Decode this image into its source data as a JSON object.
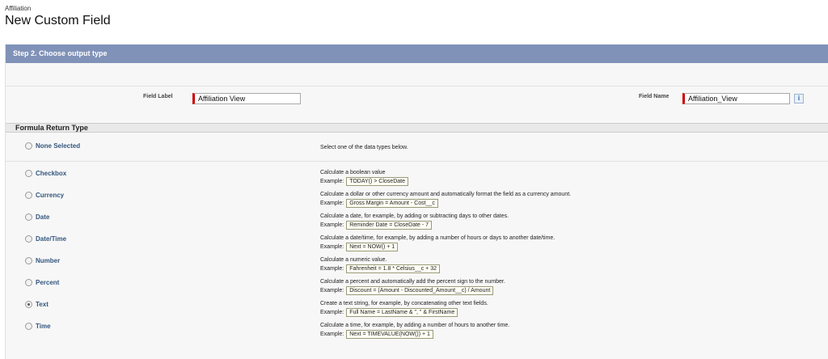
{
  "header": {
    "breadcrumb": "Affiliation",
    "title": "New Custom Field"
  },
  "step": {
    "title": "Step 2. Choose output type"
  },
  "fields": {
    "field_label": "Field Label",
    "field_label_value": "Affiliation View",
    "field_name": "Field Name",
    "field_name_value": "Affiliation_View",
    "info_label": "i"
  },
  "formula": {
    "section_title": "Formula Return Type",
    "example_prefix": "Example:",
    "none": {
      "label": "None Selected",
      "description": "Select one of the data types below."
    },
    "types": [
      {
        "label": "Checkbox",
        "description": "Calculate a boolean value",
        "example": "TODAY() > CloseDate"
      },
      {
        "label": "Currency",
        "description": "Calculate a dollar or other currency amount and automatically format the field as a currency amount.",
        "example": "Gross Margin = Amount - Cost__c"
      },
      {
        "label": "Date",
        "description": "Calculate a date, for example, by adding or subtracting days to other dates.",
        "example": "Reminder Date = CloseDate - 7"
      },
      {
        "label": "Date/Time",
        "description": "Calculate a date/time, for example, by adding a number of hours or days to another date/time.",
        "example": "Next = NOW() + 1"
      },
      {
        "label": "Number",
        "description": "Calculate a numeric value.",
        "example": "Fahrenheit = 1.8 * Celsius__c + 32"
      },
      {
        "label": "Percent",
        "description": "Calculate a percent and automatically add the percent sign to the number.",
        "example": "Discount = (Amount - Discounted_Amount__c) / Amount"
      },
      {
        "label": "Text",
        "description": "Create a text string, for example, by concatenating other text fields.",
        "example": "Full Name = LastName & \", \" & FirstName"
      },
      {
        "label": "Time",
        "description": "Calculate a time, for example, by adding a number of hours to another time.",
        "example": "Next = TIMEVALUE(NOW()) + 1"
      }
    ],
    "selected": "Text"
  }
}
